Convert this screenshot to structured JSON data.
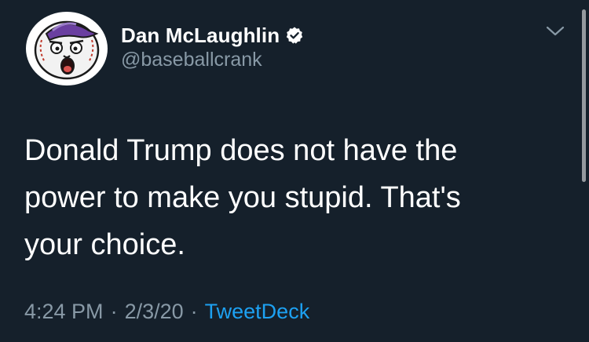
{
  "tweet": {
    "author": {
      "display_name": "Dan McLaughlin",
      "handle": "@baseballcrank",
      "verified": true,
      "avatar_icon": "baseball-face-avatar"
    },
    "text_lines": [
      "Donald Trump does not have the",
      "power to make you stupid. That's",
      "your choice."
    ],
    "time": "4:24 PM",
    "separator": "·",
    "date": "2/3/20",
    "source": "TweetDeck",
    "menu_icon": "chevron-down-icon"
  },
  "colors": {
    "background": "#15202b",
    "primary_text": "#ffffff",
    "secondary_text": "#8899a6",
    "link": "#1da1f2",
    "verified_badge": "#ffffff"
  }
}
